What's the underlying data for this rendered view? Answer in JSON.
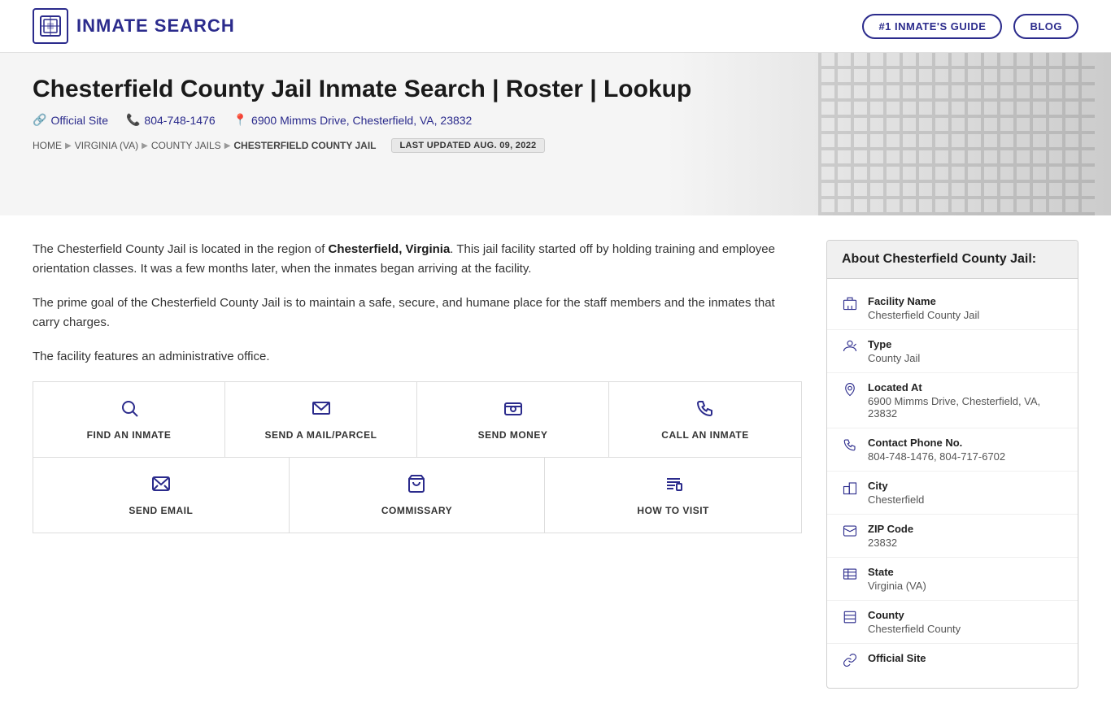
{
  "header": {
    "logo_text": "INMATE SEARCH",
    "nav_guide": "#1 INMATE'S GUIDE",
    "nav_blog": "BLOG"
  },
  "hero": {
    "title": "Chesterfield County Jail Inmate Search | Roster | Lookup",
    "official_site_label": "Official Site",
    "phone": "804-748-1476",
    "address": "6900 Mimms Drive, Chesterfield, VA, 23832",
    "last_updated": "LAST UPDATED AUG. 09, 2022"
  },
  "breadcrumb": {
    "home": "HOME",
    "state": "VIRGINIA (VA)",
    "category": "COUNTY JAILS",
    "current": "CHESTERFIELD COUNTY JAIL"
  },
  "description": {
    "para1_prefix": "The Chesterfield County Jail is located in the region of ",
    "para1_bold": "Chesterfield, Virginia",
    "para1_suffix": ". This jail facility started off by holding training and employee orientation classes. It was a few months later, when the inmates began arriving at the facility.",
    "para2": "The prime goal of the Chesterfield County Jail is to maintain a safe, secure, and humane place for the staff members and the inmates that carry charges.",
    "para3": "The facility features an administrative office."
  },
  "actions": [
    {
      "label": "FIND AN INMATE",
      "icon": "🔍"
    },
    {
      "label": "SEND A MAIL/PARCEL",
      "icon": "✉"
    },
    {
      "label": "SEND MONEY",
      "icon": "📷"
    },
    {
      "label": "CALL AN INMATE",
      "icon": "📞"
    }
  ],
  "actions_bottom": [
    {
      "label": "SEND EMAIL",
      "icon": "💬"
    },
    {
      "label": "COMMISSARY",
      "icon": "🛒"
    },
    {
      "label": "HOW TO VISIT",
      "icon": "📋"
    }
  ],
  "about": {
    "title": "About Chesterfield County Jail:",
    "rows": [
      {
        "icon": "🏢",
        "label": "Facility Name",
        "value": "Chesterfield County Jail"
      },
      {
        "icon": "👤",
        "label": "Type",
        "value": "County Jail"
      },
      {
        "icon": "📍",
        "label": "Located At",
        "value": "6900 Mimms Drive, Chesterfield, VA, 23832"
      },
      {
        "icon": "📞",
        "label": "Contact Phone No.",
        "value": "804-748-1476, 804-717-6702"
      },
      {
        "icon": "🏙",
        "label": "City",
        "value": "Chesterfield"
      },
      {
        "icon": "✉",
        "label": "ZIP Code",
        "value": "23832"
      },
      {
        "icon": "🗺",
        "label": "State",
        "value": "Virginia (VA)"
      },
      {
        "icon": "🗂",
        "label": "County",
        "value": "Chesterfield County"
      },
      {
        "icon": "🔗",
        "label": "Official Site",
        "value": ""
      }
    ]
  }
}
